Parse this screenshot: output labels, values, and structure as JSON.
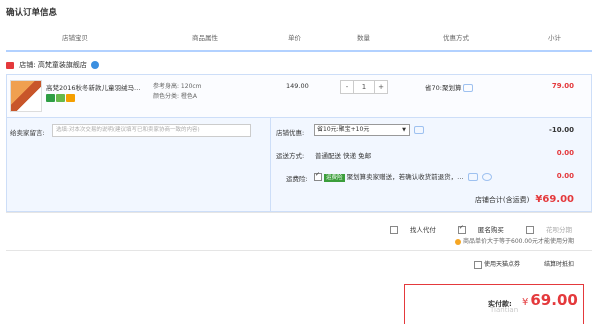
{
  "page_title": "确认订单信息",
  "columns": [
    "店铺宝贝",
    "商品属性",
    "单价",
    "数量",
    "优惠方式",
    "小计"
  ],
  "shop": {
    "label": "店铺: 高梵童装旗舰店"
  },
  "item": {
    "name": "高梵2016秋冬新款儿童羽绒马…",
    "attr_line1": "参考身高: 120cm",
    "attr_line2": "颜色分类: 橙色A",
    "price": "149.00",
    "qty": "1",
    "minus": "-",
    "plus": "+",
    "promo": "省70:聚划算",
    "subtotal": "79.00"
  },
  "message": {
    "label": "给卖家留言:",
    "placeholder": "选填:对本次交易的说明(建议填写已和卖家协商一致的内容)"
  },
  "options": {
    "coupon_label": "店铺优惠:",
    "coupon_select": "省10元:聚宝+10元",
    "coupon_amount": "-10.00",
    "shipping_label": "运送方式:",
    "shipping_text": "普通配送 快递 免邮",
    "shipping_amount": "0.00",
    "insurance_label": "运费险:",
    "insurance_tag": "运费险",
    "insurance_text": "聚划算卖家赠送，若确认收货前退货，…",
    "insurance_amount": "0.00",
    "store_total_label": "店铺合计(含运费)",
    "store_total": "¥69.00"
  },
  "pay": {
    "proxy": "找人代付",
    "anonymous": "匿名购买",
    "huabei": "花呗分期",
    "install_note": "商品单价大于等于600.00元才能使用分期",
    "tmall_points": "使用天猫点券",
    "points_note": "结算时抵扣"
  },
  "final": {
    "label": "实付款:",
    "currency": "¥",
    "amount": "69.00"
  },
  "watermark": "Tiantian"
}
